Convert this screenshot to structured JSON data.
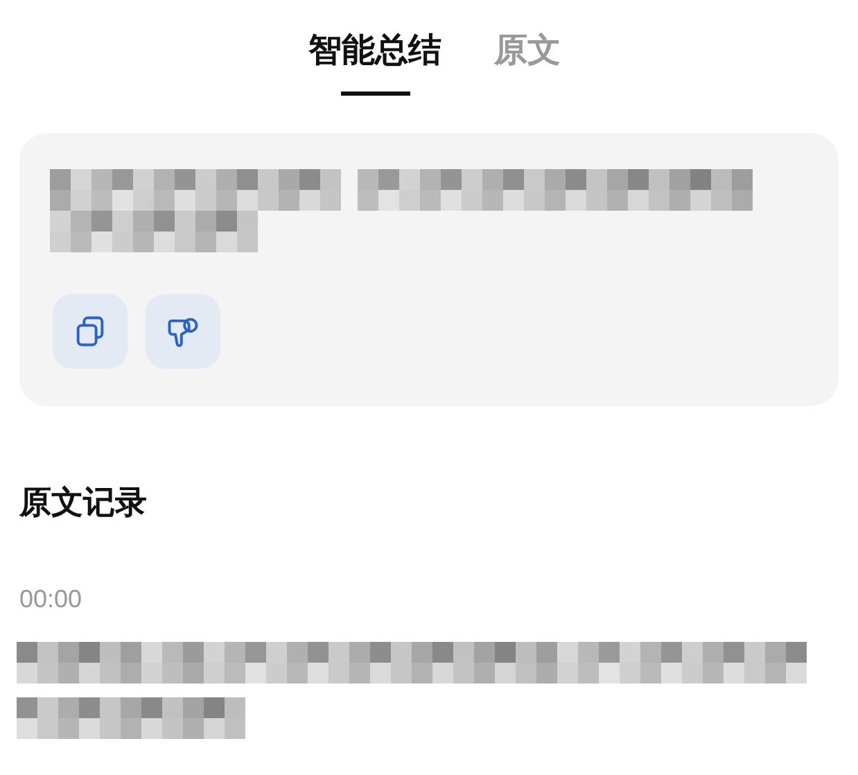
{
  "tabs": [
    {
      "label": "智能总结",
      "selected": true
    },
    {
      "label": "原文",
      "selected": false
    }
  ],
  "summary": {
    "actions": [
      {
        "kind": "copy"
      },
      {
        "kind": "dislike"
      }
    ]
  },
  "transcript": {
    "title": "原文记录",
    "entries": [
      {
        "time": "00:00"
      }
    ]
  }
}
